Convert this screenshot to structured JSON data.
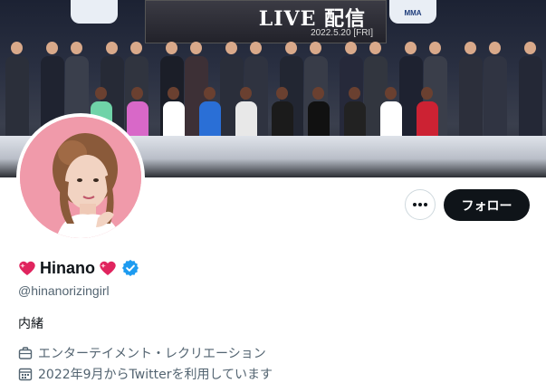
{
  "banner": {
    "sign_text": "LIVE 配信",
    "sign_subtext": "2022.5.20 [FRI]",
    "flag_text": "MMA"
  },
  "profile": {
    "display_name": "Hinano",
    "handle": "@hinanorizingirl",
    "bio": "内緒",
    "category": "エンターテイメント・レクリエーション",
    "joined": "2022年9月からTwitterを利用しています",
    "verified": true
  },
  "actions": {
    "follow_label": "フォロー",
    "more_icon": "more-dots-icon"
  },
  "colors": {
    "follow_bg": "#0f1419",
    "verified": "#1d9bf0",
    "muted_text": "#536471",
    "heart": "#e0245e",
    "avatar_bg": "#f09aaa"
  }
}
